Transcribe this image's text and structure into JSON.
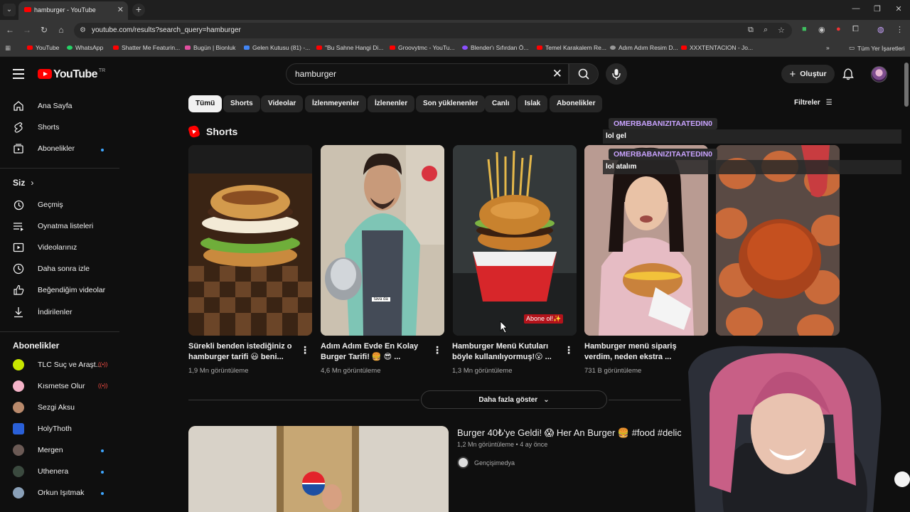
{
  "browser": {
    "tab_title": "hamburger - YouTube",
    "url": "youtube.com/results?search_query=hamburger",
    "bookmarks": [
      "YouTube",
      "WhatsApp",
      "Shatter Me Featurin...",
      "Bugün | Bionluk",
      "Gelen Kutusu (81) -...",
      "\"Bu Sahne Hangi Di...",
      "Groovytmc - YouTu...",
      "Blender'ı Sıfırdan Ö...",
      "Temel Karakalem Re...",
      "Adım Adım Resim D...",
      "XXXTENTACION - Jo..."
    ],
    "all_bookmarks": "Tüm Yer İşaretleri"
  },
  "header": {
    "logo": "YouTube",
    "country": "TR",
    "search_value": "hamburger",
    "create_label": "Oluştur"
  },
  "sidebar": {
    "main": [
      "Ana Sayfa",
      "Shorts",
      "Abonelikler"
    ],
    "you_heading": "Siz",
    "you_items": [
      "Geçmiş",
      "Oynatma listeleri",
      "Videolarınız",
      "Daha sonra izle",
      "Beğendiğim videolar",
      "İndirilenler"
    ],
    "subs_heading": "Abonelikler",
    "subs": [
      "TLC Suç ve Araşt...",
      "Kısmetse Olur",
      "Sezgi Aksu",
      "HolyThoth",
      "Mergen",
      "Uthenera",
      "Orkun Işıtmak"
    ]
  },
  "chips": [
    "Tümü",
    "Shorts",
    "Videolar",
    "İzlenmeyenler",
    "İzlenenler",
    "Son yüklenenler",
    "Canlı",
    "Islak",
    "Abonelikler"
  ],
  "filters_label": "Filtreler",
  "shorts": {
    "heading": "Shorts",
    "items": [
      {
        "title": "Sürekli benden istediğiniz o hamburger tarifi 😃 beni...",
        "views": "1,9 Mn görüntüleme"
      },
      {
        "title": "Adım Adım Evde En Kolay Burger Tarifi! 🍔 😎 ...",
        "views": "4,6 Mn görüntüleme",
        "overlay": "tava da"
      },
      {
        "title": "Hamburger Menü Kutuları böyle kullanılıyormuş!😮 ...",
        "views": "1,3 Mn görüntüleme",
        "overlay": "Abone ol!✨"
      },
      {
        "title": "Hamburger menü sipariş verdim, neden ekstra ...",
        "views": "731 B görüntüleme"
      },
      {
        "title": "",
        "views": ""
      }
    ]
  },
  "more_label": "Daha fazla göster",
  "video": {
    "title": "Burger 40₺'ye Geldi! 😱 Her An Burger 🍔 #food #delic",
    "meta": "1,2 Mn görüntüleme • 4 ay önce",
    "channel": "Gençişimedya"
  },
  "chat": [
    {
      "user": "OMERBABANIZITAATEDIN0",
      "msg": "lol gel"
    },
    {
      "user": "OMERBABANIZITAATEDIN0",
      "msg": "lol atalım"
    }
  ],
  "colors": {
    "accent": "#ff0000",
    "link": "#3ea6ff",
    "chat_name": "#c9a3ff"
  }
}
